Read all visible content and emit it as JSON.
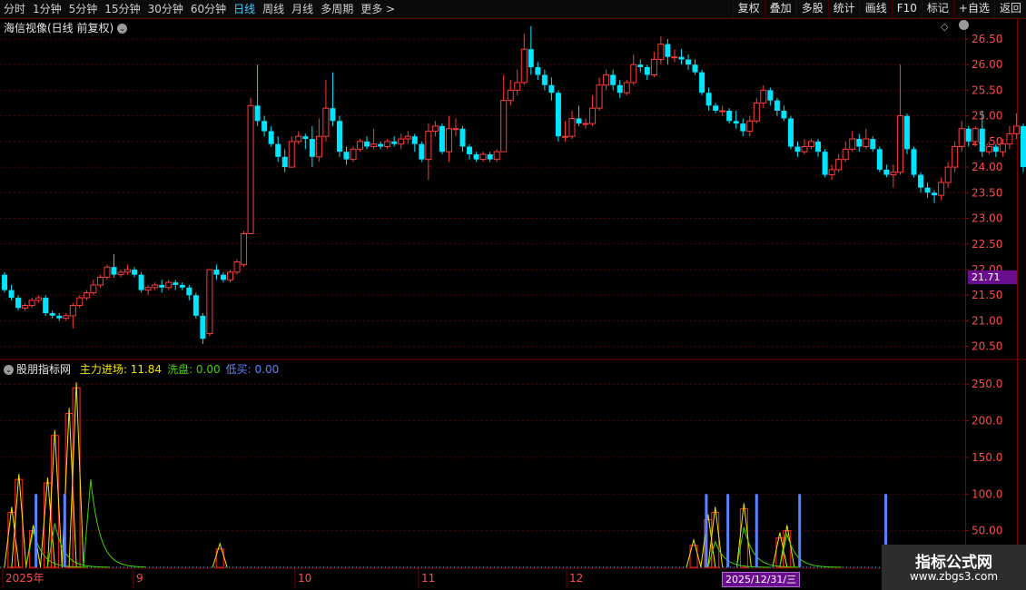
{
  "toolbar": {
    "periods": [
      "分时",
      "1分钟",
      "5分钟",
      "15分钟",
      "30分钟",
      "60分钟",
      "日线",
      "周线",
      "月线",
      "多周期",
      "更多"
    ],
    "active_period": "日线",
    "tools": [
      "复权",
      "叠加",
      "多股",
      "统计",
      "画线",
      "F10",
      "标记",
      "+自选",
      "返回"
    ]
  },
  "main_panel": {
    "title": "海信视像(日线 前复权)",
    "current_price_label": "21.71",
    "y_ticks": [
      "26.50",
      "26.00",
      "25.50",
      "25.00",
      "24.50",
      "24.00",
      "23.50",
      "23.00",
      "22.50",
      "22.00",
      "21.50",
      "21.00",
      "20.50"
    ]
  },
  "indicator_panel": {
    "name": "股朋指标网",
    "lines": [
      {
        "label": "主力进场: 11.84",
        "color": "#f2e600"
      },
      {
        "label": "洗盘: 0.00",
        "color": "#43d400"
      },
      {
        "label": "低买: 0.00",
        "color": "#5a84ff"
      }
    ],
    "y_ticks": [
      "250.0",
      "200.0",
      "150.0",
      "100.0",
      "50.00"
    ]
  },
  "x_axis": {
    "labels": [
      "2025年",
      "9",
      "10",
      "11",
      "12"
    ],
    "cursor_date": "2025/12/31/三"
  },
  "watermark": {
    "title": "指标公式网",
    "url": "www.zbgs3.com"
  },
  "colors": {
    "up": "#ff3b3b",
    "down": "#00e5ff",
    "grid": "#5a0000",
    "axis_text": "#ff4a4a"
  },
  "chart_data": [
    {
      "type": "candlestick",
      "title": "海信视像(日线 前复权)",
      "ylim": [
        20.3,
        26.8
      ],
      "candles": [
        [
          21.9,
          21.6,
          21.95,
          21.55
        ],
        [
          21.6,
          21.45,
          21.7,
          21.4
        ],
        [
          21.45,
          21.25,
          21.5,
          21.2
        ],
        [
          21.25,
          21.3,
          21.35,
          21.2
        ],
        [
          21.3,
          21.4,
          21.45,
          21.25
        ],
        [
          21.4,
          21.45,
          21.5,
          21.35
        ],
        [
          21.45,
          21.15,
          21.5,
          21.1
        ],
        [
          21.15,
          21.1,
          21.2,
          21.05
        ],
        [
          21.1,
          21.05,
          21.15,
          21.0
        ],
        [
          21.05,
          21.1,
          21.15,
          21.0
        ],
        [
          21.1,
          21.3,
          21.35,
          20.85
        ],
        [
          21.3,
          21.45,
          21.5,
          21.25
        ],
        [
          21.45,
          21.55,
          21.6,
          21.4
        ],
        [
          21.55,
          21.7,
          21.8,
          21.5
        ],
        [
          21.7,
          21.85,
          21.9,
          21.65
        ],
        [
          21.85,
          22.05,
          22.1,
          21.8
        ],
        [
          22.05,
          21.9,
          22.3,
          21.85
        ],
        [
          21.9,
          21.95,
          22.0,
          21.85
        ],
        [
          21.95,
          22.0,
          22.1,
          21.9
        ],
        [
          22.0,
          21.9,
          22.05,
          21.85
        ],
        [
          21.9,
          21.6,
          21.95,
          21.55
        ],
        [
          21.6,
          21.65,
          21.7,
          21.5
        ],
        [
          21.65,
          21.7,
          21.75,
          21.6
        ],
        [
          21.7,
          21.65,
          21.8,
          21.55
        ],
        [
          21.65,
          21.75,
          21.8,
          21.6
        ],
        [
          21.75,
          21.7,
          21.8,
          21.6
        ],
        [
          21.7,
          21.65,
          21.75,
          21.6
        ],
        [
          21.65,
          21.5,
          21.7,
          21.4
        ],
        [
          21.5,
          21.1,
          21.55,
          21.05
        ],
        [
          21.1,
          20.65,
          21.15,
          20.55
        ],
        [
          20.75,
          22.0,
          22.0,
          20.7
        ],
        [
          22.0,
          21.9,
          22.1,
          21.8
        ],
        [
          21.9,
          21.8,
          21.95,
          21.75
        ],
        [
          21.8,
          21.95,
          22.0,
          21.75
        ],
        [
          21.95,
          22.15,
          22.2,
          21.9
        ],
        [
          22.1,
          22.7,
          22.75,
          22.05
        ],
        [
          22.7,
          25.2,
          25.35,
          22.7
        ],
        [
          25.2,
          24.9,
          26.0,
          24.8
        ],
        [
          24.9,
          24.7,
          25.0,
          24.6
        ],
        [
          24.7,
          24.45,
          24.8,
          24.4
        ],
        [
          24.45,
          24.2,
          24.6,
          24.1
        ],
        [
          24.2,
          24.0,
          24.35,
          23.9
        ],
        [
          24.0,
          24.5,
          24.6,
          24.0
        ],
        [
          24.5,
          24.6,
          24.7,
          24.45
        ],
        [
          24.6,
          24.55,
          24.65,
          24.35
        ],
        [
          24.55,
          24.2,
          24.8,
          24.0
        ],
        [
          24.2,
          24.6,
          24.95,
          24.1
        ],
        [
          24.6,
          25.15,
          25.7,
          24.5
        ],
        [
          25.15,
          24.9,
          25.85,
          24.8
        ],
        [
          24.9,
          24.3,
          25.0,
          24.2
        ],
        [
          24.3,
          24.15,
          24.4,
          24.05
        ],
        [
          24.15,
          24.35,
          24.4,
          24.1
        ],
        [
          24.35,
          24.5,
          24.55,
          24.3
        ],
        [
          24.5,
          24.4,
          24.6,
          24.35
        ],
        [
          24.4,
          24.45,
          24.75,
          24.35
        ],
        [
          24.45,
          24.4,
          24.5,
          24.35
        ],
        [
          24.4,
          24.5,
          24.55,
          24.35
        ],
        [
          24.5,
          24.45,
          24.6,
          24.4
        ],
        [
          24.45,
          24.55,
          24.65,
          24.35
        ],
        [
          24.55,
          24.6,
          24.7,
          24.45
        ],
        [
          24.6,
          24.45,
          24.65,
          24.3
        ],
        [
          24.45,
          24.15,
          24.5,
          24.1
        ],
        [
          24.15,
          24.7,
          24.85,
          23.75
        ],
        [
          24.7,
          24.8,
          24.9,
          24.6
        ],
        [
          24.8,
          24.3,
          24.85,
          24.25
        ],
        [
          24.3,
          24.75,
          25.0,
          24.1
        ],
        [
          24.75,
          24.75,
          24.95,
          24.6
        ],
        [
          24.75,
          24.4,
          24.8,
          24.3
        ],
        [
          24.4,
          24.25,
          24.45,
          24.15
        ],
        [
          24.25,
          24.15,
          24.3,
          24.1
        ],
        [
          24.15,
          24.25,
          24.3,
          24.1
        ],
        [
          24.25,
          24.15,
          24.3,
          24.1
        ],
        [
          24.15,
          24.3,
          24.35,
          24.1
        ],
        [
          24.3,
          25.3,
          25.8,
          24.3
        ],
        [
          25.3,
          25.5,
          25.7,
          25.2
        ],
        [
          25.5,
          25.65,
          25.9,
          25.4
        ],
        [
          25.65,
          26.3,
          26.6,
          25.6
        ],
        [
          26.3,
          25.95,
          26.75,
          25.8
        ],
        [
          25.95,
          25.8,
          26.05,
          25.7
        ],
        [
          25.8,
          25.6,
          25.9,
          25.5
        ],
        [
          25.6,
          25.45,
          25.75,
          25.3
        ],
        [
          25.45,
          24.6,
          25.5,
          24.5
        ],
        [
          24.6,
          24.6,
          24.9,
          24.5
        ],
        [
          24.6,
          24.95,
          25.1,
          24.55
        ],
        [
          24.95,
          24.85,
          25.2,
          24.8
        ],
        [
          24.85,
          24.85,
          24.95,
          24.75
        ],
        [
          24.85,
          25.15,
          25.4,
          24.8
        ],
        [
          25.15,
          25.6,
          25.75,
          25.1
        ],
        [
          25.6,
          25.8,
          25.9,
          25.5
        ],
        [
          25.8,
          25.6,
          25.9,
          25.5
        ],
        [
          25.6,
          25.45,
          25.7,
          25.35
        ],
        [
          25.45,
          25.65,
          25.7,
          25.4
        ],
        [
          25.65,
          26.0,
          26.2,
          25.6
        ],
        [
          26.0,
          25.95,
          26.1,
          25.85
        ],
        [
          25.95,
          25.8,
          26.0,
          25.7
        ],
        [
          25.8,
          26.1,
          26.25,
          25.75
        ],
        [
          26.1,
          26.4,
          26.55,
          26.0
        ],
        [
          26.4,
          26.15,
          26.5,
          26.0
        ],
        [
          26.15,
          26.15,
          26.3,
          26.05
        ],
        [
          26.15,
          26.1,
          26.3,
          26.0
        ],
        [
          26.1,
          26.0,
          26.2,
          25.9
        ],
        [
          26.0,
          25.85,
          26.1,
          25.8
        ],
        [
          25.85,
          25.45,
          25.9,
          25.4
        ],
        [
          25.45,
          25.2,
          25.55,
          25.1
        ],
        [
          25.2,
          25.1,
          25.25,
          25.05
        ],
        [
          25.1,
          25.1,
          25.2,
          25.0
        ],
        [
          25.1,
          24.9,
          25.15,
          24.85
        ],
        [
          24.9,
          24.85,
          25.1,
          24.75
        ],
        [
          24.85,
          24.7,
          24.95,
          24.6
        ],
        [
          24.7,
          24.9,
          25.0,
          24.6
        ],
        [
          24.9,
          25.25,
          25.35,
          24.85
        ],
        [
          25.25,
          25.5,
          25.6,
          25.15
        ],
        [
          25.5,
          25.3,
          25.55,
          25.2
        ],
        [
          25.3,
          25.1,
          25.35,
          25.0
        ],
        [
          25.1,
          24.95,
          25.2,
          24.9
        ],
        [
          24.95,
          24.4,
          25.0,
          24.35
        ],
        [
          24.4,
          24.3,
          24.5,
          24.2
        ],
        [
          24.3,
          24.4,
          24.55,
          24.25
        ],
        [
          24.4,
          24.5,
          24.55,
          24.35
        ],
        [
          24.5,
          24.3,
          24.55,
          24.2
        ],
        [
          24.3,
          23.85,
          24.35,
          23.8
        ],
        [
          23.85,
          23.95,
          24.05,
          23.75
        ],
        [
          23.95,
          24.15,
          24.25,
          23.9
        ],
        [
          24.15,
          24.35,
          24.5,
          24.1
        ],
        [
          24.35,
          24.55,
          24.7,
          24.3
        ],
        [
          24.55,
          24.4,
          24.65,
          24.3
        ],
        [
          24.4,
          24.55,
          24.75,
          24.35
        ],
        [
          24.55,
          24.35,
          24.6,
          24.3
        ],
        [
          24.35,
          23.95,
          24.4,
          23.9
        ],
        [
          23.95,
          23.85,
          24.05,
          23.8
        ],
        [
          23.85,
          23.9,
          24.05,
          23.6
        ],
        [
          23.9,
          25.0,
          26.0,
          23.85
        ],
        [
          25.0,
          24.35,
          25.05,
          24.25
        ],
        [
          24.35,
          23.85,
          24.4,
          23.8
        ],
        [
          23.85,
          23.6,
          23.9,
          23.5
        ],
        [
          23.6,
          23.5,
          23.7,
          23.4
        ],
        [
          23.5,
          23.45,
          23.55,
          23.3
        ],
        [
          23.45,
          23.7,
          23.8,
          23.35
        ],
        [
          23.7,
          24.0,
          24.1,
          23.6
        ],
        [
          24.0,
          24.4,
          24.5,
          23.9
        ],
        [
          24.4,
          24.75,
          24.9,
          24.3
        ],
        [
          24.75,
          24.5,
          24.8,
          24.4
        ],
        [
          24.5,
          24.75,
          24.8,
          24.4
        ],
        [
          24.75,
          24.3,
          25.1,
          24.2
        ],
        [
          24.3,
          24.4,
          24.5,
          24.25
        ],
        [
          24.4,
          24.3,
          24.45,
          24.2
        ],
        [
          24.3,
          24.45,
          24.55,
          24.2
        ],
        [
          24.45,
          24.65,
          24.8,
          24.35
        ],
        [
          24.65,
          24.8,
          25.05,
          24.55
        ],
        [
          24.8,
          24.0,
          24.85,
          23.9
        ],
        [
          24.0,
          23.7,
          24.1,
          23.25
        ],
        [
          23.7,
          23.5,
          23.8,
          23.4
        ],
        [
          23.5,
          24.1,
          24.2,
          23.45
        ],
        [
          24.1,
          25.1,
          25.5,
          24.0
        ],
        [
          25.1,
          24.55,
          25.15,
          24.5
        ],
        [
          24.55,
          24.45,
          24.6,
          24.35
        ],
        [
          24.45,
          24.4,
          24.5,
          24.35
        ],
        [
          24.4,
          24.3,
          24.45,
          24.25
        ],
        [
          24.3,
          24.2,
          24.35,
          24.15
        ],
        [
          24.2,
          23.45,
          24.25,
          23.4
        ],
        [
          23.45,
          23.1,
          23.5,
          23.05
        ]
      ]
    },
    {
      "type": "bar",
      "title": "股朋指标网",
      "ylim": [
        0,
        280
      ],
      "series": [
        {
          "name": "主力进场",
          "type": "bar",
          "values": [
            [
              1,
              75
            ],
            [
              2,
              120
            ],
            [
              4,
              50
            ],
            [
              6,
              115
            ],
            [
              7,
              180
            ],
            [
              9,
              210
            ],
            [
              10,
              245
            ],
            [
              30,
              25
            ],
            [
              96,
              30
            ],
            [
              98,
              65
            ],
            [
              99,
              75
            ],
            [
              103,
              80
            ],
            [
              108,
              40
            ],
            [
              109,
              50
            ]
          ]
        },
        {
          "name": "低买",
          "type": "bar",
          "values": [
            [
              4,
              100
            ],
            [
              8,
              100
            ],
            [
              97,
              100
            ],
            [
              100,
              100
            ],
            [
              104,
              100
            ],
            [
              110,
              100
            ],
            [
              122,
              100
            ]
          ]
        }
      ]
    }
  ]
}
